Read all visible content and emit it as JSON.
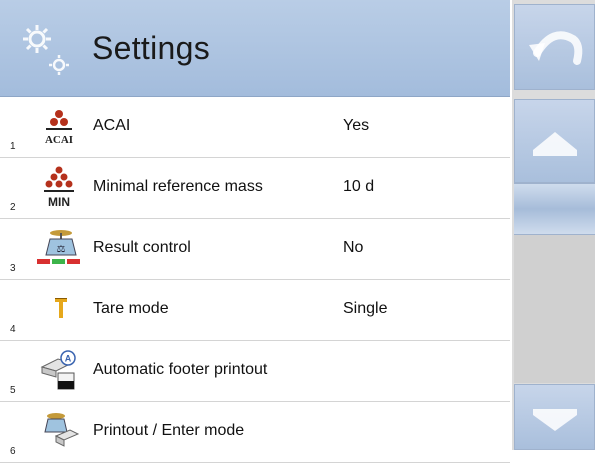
{
  "header": {
    "title": "Settings",
    "icon": "gears-icon"
  },
  "items": [
    {
      "number": "1",
      "icon": "acai-icon",
      "icon_text": "ACAI",
      "label": "ACAI",
      "value": "Yes"
    },
    {
      "number": "2",
      "icon": "min-mass-icon",
      "icon_text": "MIN",
      "label": "Minimal reference mass",
      "value": "10 d"
    },
    {
      "number": "3",
      "icon": "result-control-icon",
      "label": "Result control",
      "value": "No"
    },
    {
      "number": "4",
      "icon": "tare-icon",
      "label": "Tare mode",
      "value": "Single"
    },
    {
      "number": "5",
      "icon": "printer-footer-icon",
      "icon_text": "A",
      "label": "Automatic footer printout",
      "value": ""
    },
    {
      "number": "6",
      "icon": "print-scale-icon",
      "label": "Printout / Enter mode",
      "value": ""
    }
  ],
  "sidebar": {
    "back_icon": "back-arrow-icon",
    "up_icon": "arrow-up-icon",
    "down_icon": "arrow-down-icon",
    "scroll_position": 0.0
  },
  "colors": {
    "header": "#a9c0de",
    "button": "#b8cae4",
    "divider": "#d4d4d4",
    "scroll_track": "#d0d0d0"
  }
}
